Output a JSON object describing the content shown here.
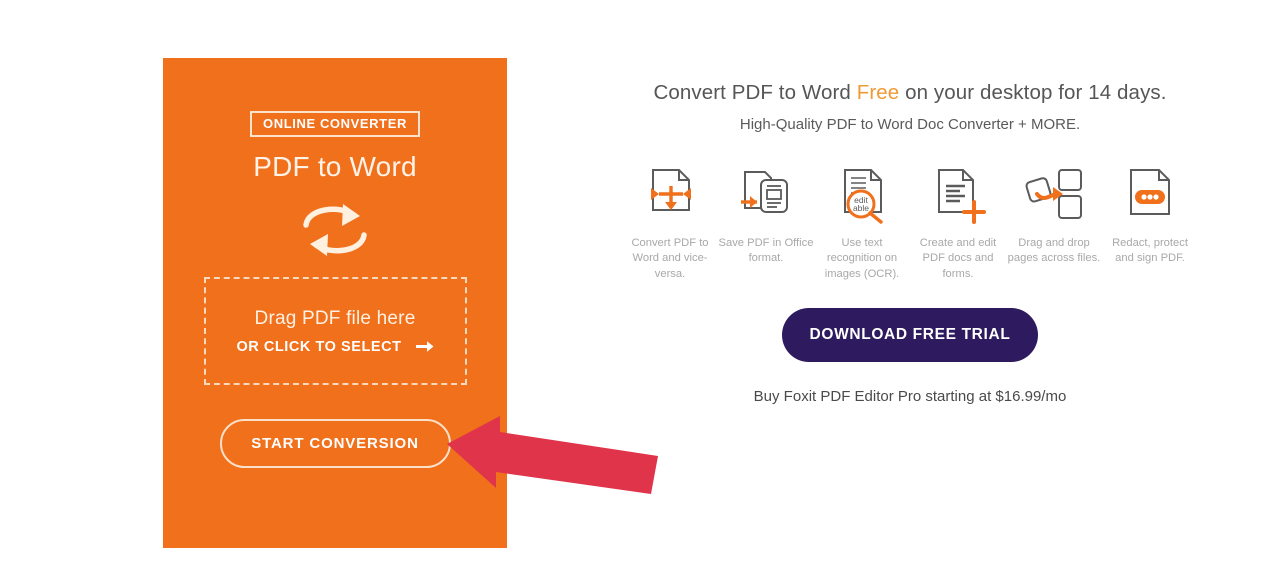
{
  "converter_panel": {
    "badge_label": "ONLINE CONVERTER",
    "title": "PDF to Word",
    "swap_icon_name": "swap-arrows-icon",
    "dropzone": {
      "main_text": "Drag PDF file here",
      "sub_text": "OR CLICK TO SELECT",
      "arrow_icon_name": "arrow-right-icon"
    },
    "start_button_label": "START CONVERSION",
    "panel_color": "#F0701C"
  },
  "promo": {
    "headline_part1": "Convert PDF to Word ",
    "headline_accent": "Free",
    "headline_part2": " on your desktop for 14 days.",
    "headline_accent_color": "#EF9A34",
    "subheadline": "High-Quality PDF to Word Doc Converter + MORE.",
    "cta_label": "DOWNLOAD FREE TRIAL",
    "cta_color": "#2E1A5E",
    "price_note": "Buy Foxit PDF Editor Pro starting at $16.99/mo",
    "features": [
      {
        "icon": "convert-both-ways-icon",
        "caption": "Convert PDF to Word and vice-versa."
      },
      {
        "icon": "save-office-format-icon",
        "caption": "Save PDF in Office format."
      },
      {
        "icon": "ocr-editable-icon",
        "caption": "Use text recognition on images (OCR)."
      },
      {
        "icon": "create-edit-pdf-icon",
        "caption": "Create and edit PDF docs and forms."
      },
      {
        "icon": "drag-drop-pages-icon",
        "caption": "Drag and drop pages across files."
      },
      {
        "icon": "redact-protect-icon",
        "caption": "Redact, protect and sign PDF."
      }
    ]
  },
  "annotation": {
    "arrow_icon_name": "annotation-arrow-left-icon",
    "arrow_color": "#E0344B"
  }
}
